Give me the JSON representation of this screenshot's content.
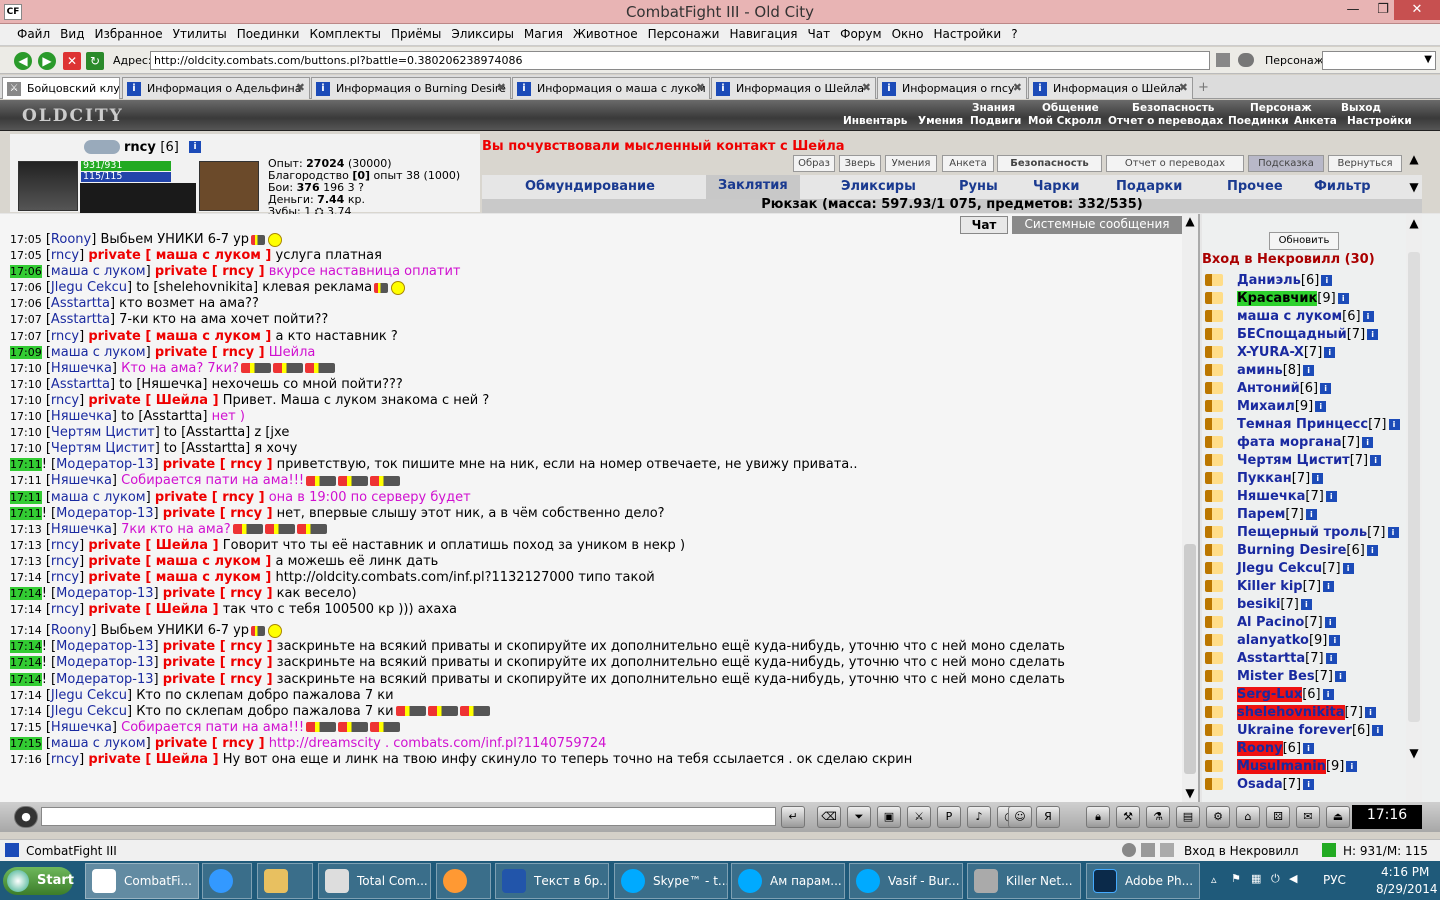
{
  "window": {
    "title": "CombatFight III - Old City",
    "app_icon": "CF"
  },
  "menu": [
    "Файл",
    "Вид",
    "Избранное",
    "Утилиты",
    "Поединки",
    "Комплекты",
    "Приёмы",
    "Эликсиры",
    "Магия",
    "Животное",
    "Персонажи",
    "Навигация",
    "Чат",
    "Форум",
    "Окно",
    "Настройки",
    "?"
  ],
  "address": {
    "label": "Адрес:",
    "url": "http://oldcity.combats.com/buttons.pl?battle=0.380206238974086",
    "char_label": "Персонаж:"
  },
  "tabs": [
    {
      "label": "Бойцовский клуб"
    },
    {
      "label": "Информация о Адельфина"
    },
    {
      "label": "Информация о Burning Desire"
    },
    {
      "label": "Информация о маша с луком"
    },
    {
      "label": "Информация о Шейла"
    },
    {
      "label": "Информация о rncy"
    },
    {
      "label": "Информация о Шейла"
    }
  ],
  "game": {
    "logo": "OLDCITY",
    "top_links1": [
      "Знания",
      "Общение",
      "Безопасность",
      "Персонаж",
      "Выход"
    ],
    "top_links2": [
      "Инвентарь",
      "Умения",
      "Подвиги",
      "Мой Скролл",
      "Отчет о переводах",
      "Поединки",
      "Анкета",
      "Настройки"
    ],
    "character": {
      "name": "rncy",
      "level": "[6]",
      "hp": "931/931",
      "mana": "115/115",
      "stats": [
        {
          "label": "Опыт:",
          "value": "27024",
          "extra": "(30000)"
        },
        {
          "label": "Благородство",
          "value": "[0]",
          "extra": "опыт 38 (1000)"
        },
        {
          "label": "Бои:",
          "value": "376",
          "extra": "196   3 ?"
        },
        {
          "label": "Деньги:",
          "value": "7.44",
          "extra": "кр."
        },
        {
          "label": "Зубы:",
          "value": "1 ⛭ 3.74",
          "extra": ""
        }
      ]
    },
    "notice": "Вы почувствовали мысленный контакт с Шейла",
    "small_buttons": [
      "Образ",
      "Зверь",
      "Умения",
      "Анкета",
      "Безопасность",
      "Отчет о переводах",
      "Подсказка",
      "Вернуться"
    ],
    "inv_tabs": [
      "Обмундирование",
      "Заклятия",
      "Эликсиры",
      "Руны",
      "Чарки",
      "Подарки",
      "Прочее",
      "Фильтр"
    ],
    "active_inv_tab": "Заклятия",
    "backpack": "Рюкзак (масса: 597.93/1 075, предметов: 332/535)"
  },
  "chat": {
    "tabs": [
      "Чат",
      "Системные сообщения"
    ],
    "messages": [
      {
        "time": "17:05",
        "hl": false,
        "pre": "",
        "nick": "Roony",
        "priv": "",
        "to": "",
        "text": "Выбьем УНИКИ 6-7 ур",
        "pink": false,
        "icons": "smile"
      },
      {
        "time": "17:05",
        "hl": false,
        "pre": "",
        "nick": "rncy",
        "priv": "private [ маша с луком ]",
        "to": "",
        "text": "услуга платная",
        "pink": false,
        "icons": ""
      },
      {
        "time": "17:06",
        "hl": true,
        "pre": "",
        "nick": "маша с луком",
        "priv": "private [ rncy ]",
        "to": "",
        "text": "вкурсе наставница оплатит",
        "pink": true,
        "icons": ""
      },
      {
        "time": "17:06",
        "hl": false,
        "pre": "",
        "nick": "Jlegu Cekcu",
        "priv": "",
        "to": "to [shelehovnikita]",
        "text": "клевая реклама",
        "pink": false,
        "icons": "smile"
      },
      {
        "time": "17:06",
        "hl": false,
        "pre": "",
        "nick": "Asstartta",
        "priv": "",
        "to": "",
        "text": "кто возмет на ама??",
        "pink": false,
        "icons": ""
      },
      {
        "time": "17:07",
        "hl": false,
        "pre": "",
        "nick": "Asstartta",
        "priv": "",
        "to": "",
        "text": "7-ки кто на ама хочет пойти??",
        "pink": false,
        "icons": ""
      },
      {
        "time": "17:07",
        "hl": false,
        "pre": "",
        "nick": "rncy",
        "priv": "private [ маша с луком ]",
        "to": "",
        "text": "а кто наставник ?",
        "pink": false,
        "icons": ""
      },
      {
        "time": "17:09",
        "hl": true,
        "pre": "",
        "nick": "маша с луком",
        "priv": "private [ rncy ]",
        "to": "",
        "text": "Шейла",
        "pink": true,
        "icons": ""
      },
      {
        "time": "17:10",
        "hl": false,
        "pre": "",
        "nick": "Няшечка",
        "priv": "",
        "to": "",
        "text": "Кто на ама? 7ки?",
        "pink": true,
        "icons": "guns"
      },
      {
        "time": "17:10",
        "hl": false,
        "pre": "",
        "nick": "Asstartta",
        "priv": "",
        "to": "to [Няшечка]",
        "text": "нехочешь со мной пойти???",
        "pink": false,
        "icons": ""
      },
      {
        "time": "17:10",
        "hl": false,
        "pre": "",
        "nick": "rncy",
        "priv": "private [ Шейла ]",
        "to": "",
        "text": "Привет. Маша с луком знакома с ней ?",
        "pink": false,
        "icons": ""
      },
      {
        "time": "17:10",
        "hl": false,
        "pre": "",
        "nick": "Няшечка",
        "priv": "",
        "to": "to [Asstartta]",
        "text": "нет )",
        "pink": true,
        "icons": ""
      },
      {
        "time": "17:10",
        "hl": false,
        "pre": "",
        "nick": "Чертям Цистит",
        "priv": "",
        "to": "to [Asstartta]",
        "text": "z [jxe",
        "pink": false,
        "icons": ""
      },
      {
        "time": "17:10",
        "hl": false,
        "pre": "",
        "nick": "Чертям Цистит",
        "priv": "",
        "to": "to [Asstartta]",
        "text": "я хочу",
        "pink": false,
        "icons": ""
      },
      {
        "time": "17:11",
        "hl": true,
        "pre": "!",
        "nick": "Модератор-13",
        "priv": "private [ rncy ]",
        "to": "",
        "text": "приветствую, ток пишите мне на ник, если на номер отвечаете, не увижу привата..",
        "pink": false,
        "icons": ""
      },
      {
        "time": "17:11",
        "hl": false,
        "pre": "",
        "nick": "Няшечка",
        "priv": "",
        "to": "",
        "text": "Собирается пати на ама!!!",
        "pink": true,
        "icons": "guns"
      },
      {
        "time": "17:11",
        "hl": true,
        "pre": "",
        "nick": "маша с луком",
        "priv": "private [ rncy ]",
        "to": "",
        "text": "она в 19:00 по серверу будет",
        "pink": true,
        "icons": ""
      },
      {
        "time": "17:11",
        "hl": true,
        "pre": "!",
        "nick": "Модератор-13",
        "priv": "private [ rncy ]",
        "to": "",
        "text": "нет, впервые слышу этот ник, а в чём собственно дело?",
        "pink": false,
        "icons": ""
      },
      {
        "time": "17:13",
        "hl": false,
        "pre": "",
        "nick": "Няшечка",
        "priv": "",
        "to": "",
        "text": "7ки кто на ама?",
        "pink": true,
        "icons": "guns"
      },
      {
        "time": "17:13",
        "hl": false,
        "pre": "",
        "nick": "rncy",
        "priv": "private [ Шейла ]",
        "to": "",
        "text": "Говорит что ты её наставник и оплатишь поход за уником в некр )",
        "pink": false,
        "icons": ""
      },
      {
        "time": "17:13",
        "hl": false,
        "pre": "",
        "nick": "rncy",
        "priv": "private [ маша с луком ]",
        "to": "",
        "text": "а можешь её линк дать",
        "pink": false,
        "icons": ""
      },
      {
        "time": "17:14",
        "hl": false,
        "pre": "",
        "nick": "rncy",
        "priv": "private [ маша с луком ]",
        "to": "",
        "text": "http://oldcity.combats.com/inf.pl?1132127000 типо такой",
        "pink": false,
        "icons": ""
      },
      {
        "time": "17:14",
        "hl": true,
        "pre": "!",
        "nick": "Модератор-13",
        "priv": "private [ rncy ]",
        "to": "",
        "text": "как весело)",
        "pink": false,
        "icons": ""
      },
      {
        "time": "17:14",
        "hl": false,
        "pre": "",
        "nick": "rncy",
        "priv": "private [ Шейла ]",
        "to": "",
        "text": "так что с тебя 100500 кр ))) ахаха",
        "pink": false,
        "icons": ""
      },
      {
        "time": "17:14",
        "hl": false,
        "pre": "",
        "nick": "Roony",
        "priv": "",
        "to": "",
        "text": "Выбьем УНИКИ 6-7 ур",
        "pink": false,
        "icons": "smile",
        "gap": true
      },
      {
        "time": "17:14",
        "hl": true,
        "pre": "!",
        "nick": "Модератор-13",
        "priv": "private [ rncy ]",
        "to": "",
        "text": "заскриньте на всякий приваты и скопируйте их дополнительно ещё куда-нибудь, уточню что с ней моно сделать",
        "pink": false,
        "icons": ""
      },
      {
        "time": "17:14",
        "hl": true,
        "pre": "!",
        "nick": "Модератор-13",
        "priv": "private [ rncy ]",
        "to": "",
        "text": "заскриньте на всякий приваты и скопируйте их дополнительно ещё куда-нибудь, уточню что с ней моно сделать",
        "pink": false,
        "icons": ""
      },
      {
        "time": "17:14",
        "hl": true,
        "pre": "!",
        "nick": "Модератор-13",
        "priv": "private [ rncy ]",
        "to": "",
        "text": "заскриньте на всякий приваты и скопируйте их дополнительно ещё куда-нибудь, уточню что с ней моно сделать",
        "pink": false,
        "icons": ""
      },
      {
        "time": "17:14",
        "hl": false,
        "pre": "",
        "nick": "Jlegu Cekcu",
        "priv": "",
        "to": "",
        "text": "Кто по склепам добро пажалова 7 ки",
        "pink": false,
        "icons": ""
      },
      {
        "time": "17:14",
        "hl": false,
        "pre": "",
        "nick": "Jlegu Cekcu",
        "priv": "",
        "to": "",
        "text": "Кто по склепам добро пажалова 7 ки",
        "pink": false,
        "icons": "guns"
      },
      {
        "time": "17:15",
        "hl": false,
        "pre": "",
        "nick": "Няшечка",
        "priv": "",
        "to": "",
        "text": "Собирается пати на ама!!!",
        "pink": true,
        "icons": "guns"
      },
      {
        "time": "17:15",
        "hl": true,
        "pre": "",
        "nick": "маша с луком",
        "priv": "private [ rncy ]",
        "to": "",
        "text": "http://dreamscity . combats.com/inf.pl?1140759724",
        "pink": true,
        "icons": ""
      },
      {
        "time": "17:16",
        "hl": false,
        "pre": "",
        "nick": "rncy",
        "priv": "private [ Шейла ]",
        "to": "",
        "text": "Ну вот она еще и линк на твою инфу скинуло то теперь точно на тебя ссылается . ок сделаю скрин",
        "pink": false,
        "icons": ""
      }
    ]
  },
  "users": {
    "refresh": "Обновить",
    "location": "Вход в Некровилл (30)",
    "list": [
      {
        "name": "Даниэль",
        "lvl": "[6]",
        "style": ""
      },
      {
        "name": "Красавчик",
        "lvl": "[9]",
        "style": "green"
      },
      {
        "name": "маша с луком",
        "lvl": "[6]",
        "style": ""
      },
      {
        "name": "БЕСпощадный",
        "lvl": "[7]",
        "style": ""
      },
      {
        "name": "X-YURA-X",
        "lvl": "[7]",
        "style": ""
      },
      {
        "name": "аминь",
        "lvl": "[8]",
        "style": ""
      },
      {
        "name": "Антоний",
        "lvl": "[6]",
        "style": ""
      },
      {
        "name": "Михаил",
        "lvl": "[9]",
        "style": ""
      },
      {
        "name": "Темная Принцесс",
        "lvl": "[7]",
        "style": ""
      },
      {
        "name": "фата моргана",
        "lvl": "[7]",
        "style": ""
      },
      {
        "name": "Чертям Цистит",
        "lvl": "[7]",
        "style": ""
      },
      {
        "name": "Пуккан",
        "lvl": "[7]",
        "style": ""
      },
      {
        "name": "Няшечка",
        "lvl": "[7]",
        "style": ""
      },
      {
        "name": "Парем",
        "lvl": "[7]",
        "style": ""
      },
      {
        "name": "Пещерный троль",
        "lvl": "[7]",
        "style": ""
      },
      {
        "name": "Burning Desire",
        "lvl": "[6]",
        "style": ""
      },
      {
        "name": "Jlegu Cekcu",
        "lvl": "[7]",
        "style": ""
      },
      {
        "name": "Killer kip",
        "lvl": "[7]",
        "style": ""
      },
      {
        "name": "besiki",
        "lvl": "[7]",
        "style": ""
      },
      {
        "name": "Al Pacino",
        "lvl": "[7]",
        "style": ""
      },
      {
        "name": "alanyatko",
        "lvl": "[9]",
        "style": ""
      },
      {
        "name": "Asstartta",
        "lvl": "[7]",
        "style": ""
      },
      {
        "name": "Mister Bes",
        "lvl": "[7]",
        "style": ""
      },
      {
        "name": "Serg-Lux",
        "lvl": "[6]",
        "style": "red"
      },
      {
        "name": "shelehovnikita",
        "lvl": "[7]",
        "style": "red"
      },
      {
        "name": "Ukraine forever",
        "lvl": "[6]",
        "style": ""
      },
      {
        "name": "Roony",
        "lvl": "[6]",
        "style": "red"
      },
      {
        "name": "Musulmanin",
        "lvl": "[9]",
        "style": "red"
      },
      {
        "name": "Osada",
        "lvl": "[7]",
        "style": ""
      }
    ]
  },
  "clock": "17:16",
  "status": {
    "left": "CombatFight III",
    "location": "Вход в Некровилл",
    "hp": "H: 931/M: 115"
  },
  "taskbar": {
    "start": "Start",
    "items": [
      "CombatFi...",
      "",
      "",
      "Total Com...",
      "",
      "Текст в бр...",
      "Skype™ - t...",
      "Ам парам...",
      "Vasif - Bur...",
      "Killer Net...",
      "Adobe Ph..."
    ],
    "lang": "РУС",
    "time": "4:16 PM",
    "date": "8/29/2014"
  }
}
